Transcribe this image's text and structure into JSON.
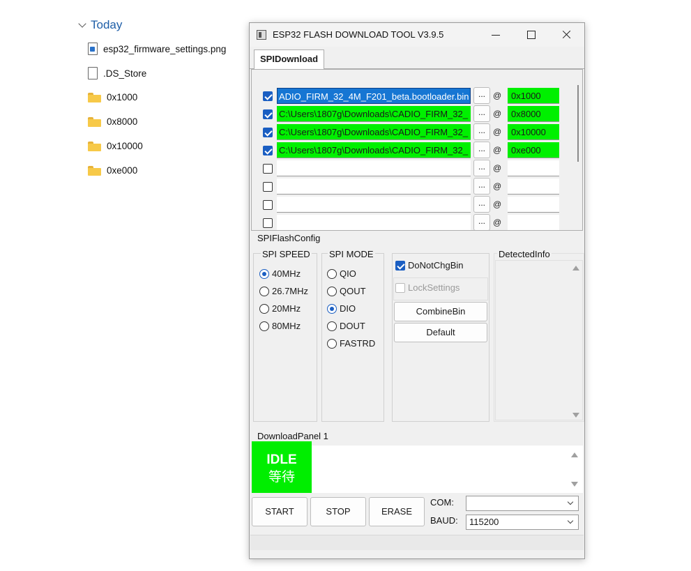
{
  "explorer": {
    "group_label": "Today",
    "items": [
      {
        "name": "esp32_firmware_settings.png",
        "type": "png"
      },
      {
        "name": ".DS_Store",
        "type": "file"
      },
      {
        "name": "0x1000",
        "type": "folder"
      },
      {
        "name": "0x8000",
        "type": "folder"
      },
      {
        "name": "0x10000",
        "type": "folder"
      },
      {
        "name": "0xe000",
        "type": "folder"
      }
    ]
  },
  "window": {
    "title": "ESP32 FLASH DOWNLOAD TOOL V3.9.5",
    "tab": "SPIDownload",
    "browse_label": "...",
    "at_symbol": "@",
    "file_rows": [
      {
        "checked": true,
        "path": "ADIO_FIRM_32_4M_F201_beta.bootloader.bin",
        "address": "0x1000"
      },
      {
        "checked": true,
        "path": "C:\\Users\\1807g\\Downloads\\CADIO_FIRM_32_",
        "address": "0x8000"
      },
      {
        "checked": true,
        "path": "C:\\Users\\1807g\\Downloads\\CADIO_FIRM_32_",
        "address": "0x10000"
      },
      {
        "checked": true,
        "path": "C:\\Users\\1807g\\Downloads\\CADIO_FIRM_32_",
        "address": "0xe000"
      },
      {
        "checked": false,
        "path": "",
        "address": ""
      },
      {
        "checked": false,
        "path": "",
        "address": ""
      },
      {
        "checked": false,
        "path": "",
        "address": ""
      },
      {
        "checked": false,
        "path": "",
        "address": ""
      }
    ],
    "spi_flash_config": {
      "label": "SPIFlashConfig",
      "spi_speed": {
        "label": "SPI SPEED",
        "options": [
          "40MHz",
          "26.7MHz",
          "20MHz",
          "80MHz"
        ],
        "selected": "40MHz"
      },
      "spi_mode": {
        "label": "SPI MODE",
        "options": [
          "QIO",
          "QOUT",
          "DIO",
          "DOUT",
          "FASTRD"
        ],
        "selected": "DIO"
      },
      "do_not_chg_bin": {
        "label": "DoNotChgBin",
        "checked": true
      },
      "lock_settings": {
        "label": "LockSettings",
        "checked": false,
        "disabled": true
      },
      "combine_bin_label": "CombineBin",
      "default_label": "Default",
      "detected_info_label": "DetectedInfo"
    },
    "download_panel": {
      "label": "DownloadPanel 1",
      "status_en": "IDLE",
      "status_cn": "等待",
      "status_color": "#00ee00",
      "start_label": "START",
      "stop_label": "STOP",
      "erase_label": "ERASE",
      "com_label": "COM:",
      "com_value": "",
      "baud_label": "BAUD:",
      "baud_value": "115200"
    }
  }
}
